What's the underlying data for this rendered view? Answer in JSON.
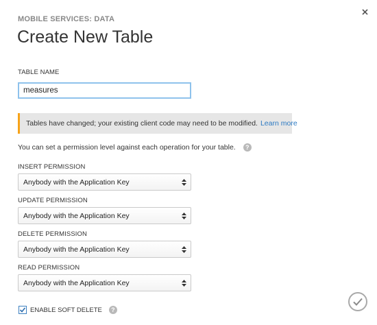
{
  "header": {
    "breadcrumb": "MOBILE SERVICES: DATA",
    "title": "Create New Table",
    "close_icon": "close-icon"
  },
  "table_name": {
    "label": "TABLE NAME",
    "value": "measures"
  },
  "notice": {
    "text": "Tables have changed; your existing client code may need to be modified.",
    "link_text": "Learn more",
    "accent_color": "#f7a319",
    "link_color": "#2b79c2"
  },
  "permissions": {
    "intro": "You can set a permission level against each operation for your table.",
    "help_icon": "help-icon",
    "insert": {
      "label": "INSERT PERMISSION",
      "value": "Anybody with the Application Key"
    },
    "update": {
      "label": "UPDATE PERMISSION",
      "value": "Anybody with the Application Key"
    },
    "delete": {
      "label": "DELETE PERMISSION",
      "value": "Anybody with the Application Key"
    },
    "read": {
      "label": "READ PERMISSION",
      "value": "Anybody with the Application Key"
    }
  },
  "soft_delete": {
    "label": "ENABLE SOFT DELETE",
    "checked": true
  },
  "footer": {
    "confirm_icon": "checkmark-icon"
  }
}
